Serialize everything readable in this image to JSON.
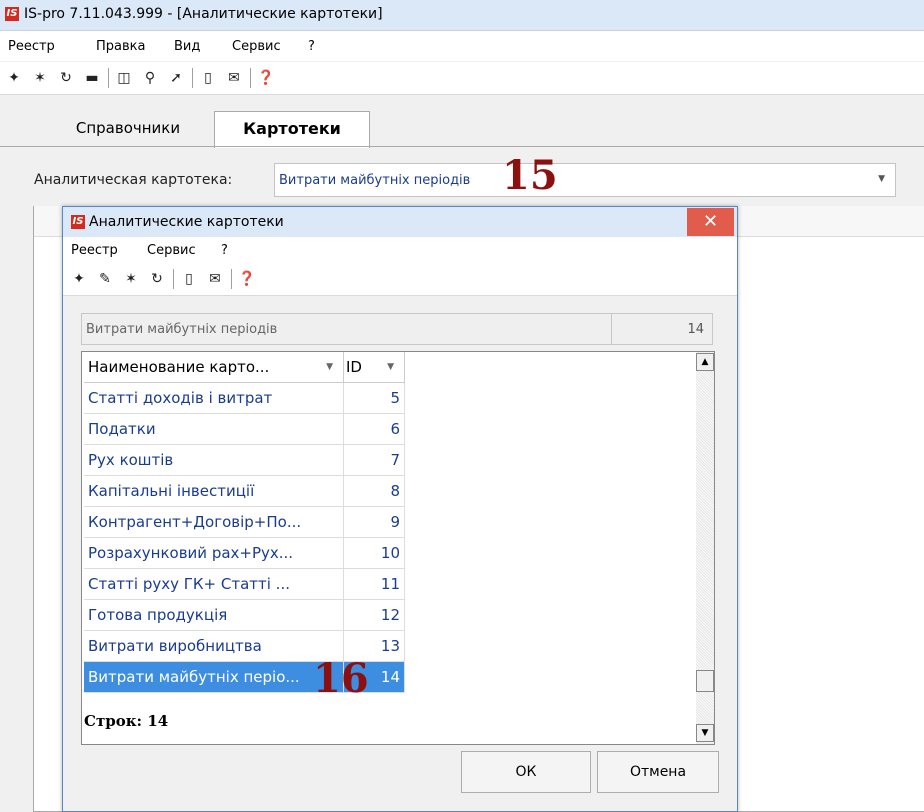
{
  "window": {
    "title": "IS-pro 7.11.043.999 - [Аналитические картотеки]",
    "logo": "IS"
  },
  "menu": [
    "Реестр",
    "Правка",
    "Вид",
    "Сервис",
    "?"
  ],
  "toolbar_icons": [
    "new-item-icon",
    "delete-item-icon",
    "refresh-icon",
    "print-icon",
    "columns-icon",
    "search-icon",
    "find-next-icon",
    "form-icon",
    "mail-icon",
    "help-icon"
  ],
  "tabs": [
    {
      "label": "Справочники",
      "active": false
    },
    {
      "label": "Картотеки",
      "active": true
    }
  ],
  "card_field": {
    "label": "Аналитическая картотека:",
    "value": "Витрати майбутніх періодів"
  },
  "markers": {
    "a": "15",
    "b": "16"
  },
  "dialog": {
    "title": "Аналитические картотеки",
    "logo": "IS",
    "menu": [
      "Реестр",
      "Сервис",
      "?"
    ],
    "path": "Витрати майбутніх періодів",
    "count": "14",
    "columns": [
      "Наименование карто...",
      "ID"
    ],
    "rows": [
      {
        "name": "Статті доходів і витрат",
        "id": "5"
      },
      {
        "name": "Податки",
        "id": "6"
      },
      {
        "name": "Рух коштів",
        "id": "7"
      },
      {
        "name": "Капітальні інвестиції",
        "id": "8"
      },
      {
        "name": "Контрагент+Договір+По...",
        "id": "9"
      },
      {
        "name": "Розрахунковий рах+Рух...",
        "id": "10"
      },
      {
        "name": "Статті руху ГК+ Статті ...",
        "id": "11"
      },
      {
        "name": "Готова продукція",
        "id": "12"
      },
      {
        "name": "Витрати виробництва",
        "id": "13"
      },
      {
        "name": "Витрати майбутніх періо...",
        "id": "14",
        "selected": true
      }
    ],
    "status": "Строк: 14",
    "ok_label": "ОК",
    "cancel_label": "Отмена"
  },
  "colors": {
    "accent": "#3d8ee0",
    "link_text": "#1a3c8f",
    "marker": "#8b1010",
    "close": "#e25c4b"
  }
}
